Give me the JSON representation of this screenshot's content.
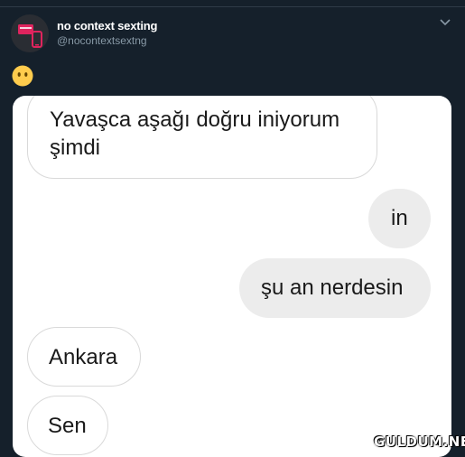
{
  "tweet": {
    "display_name": "no context sexting",
    "handle": "@nocontextsextng",
    "avatar_icon": "phone-icon",
    "menu_icon": "chevron-down-icon",
    "emoji": "neutral-face-emoji"
  },
  "messages": [
    {
      "side": "received",
      "text": "Yavaşca aşağı doğru iniyorum şimdi"
    },
    {
      "side": "sent",
      "text": "in"
    },
    {
      "side": "sent",
      "text": "şu an nerdesin"
    },
    {
      "side": "received",
      "text": "Ankara"
    },
    {
      "side": "received",
      "text": "Sen"
    }
  ],
  "watermark": "GULDUM.NET",
  "colors": {
    "background": "#15202b",
    "handle": "#8899a6",
    "sent_bubble": "#ececec",
    "avatar_accent": "#e0245e",
    "emoji": "#ffcc4d"
  }
}
